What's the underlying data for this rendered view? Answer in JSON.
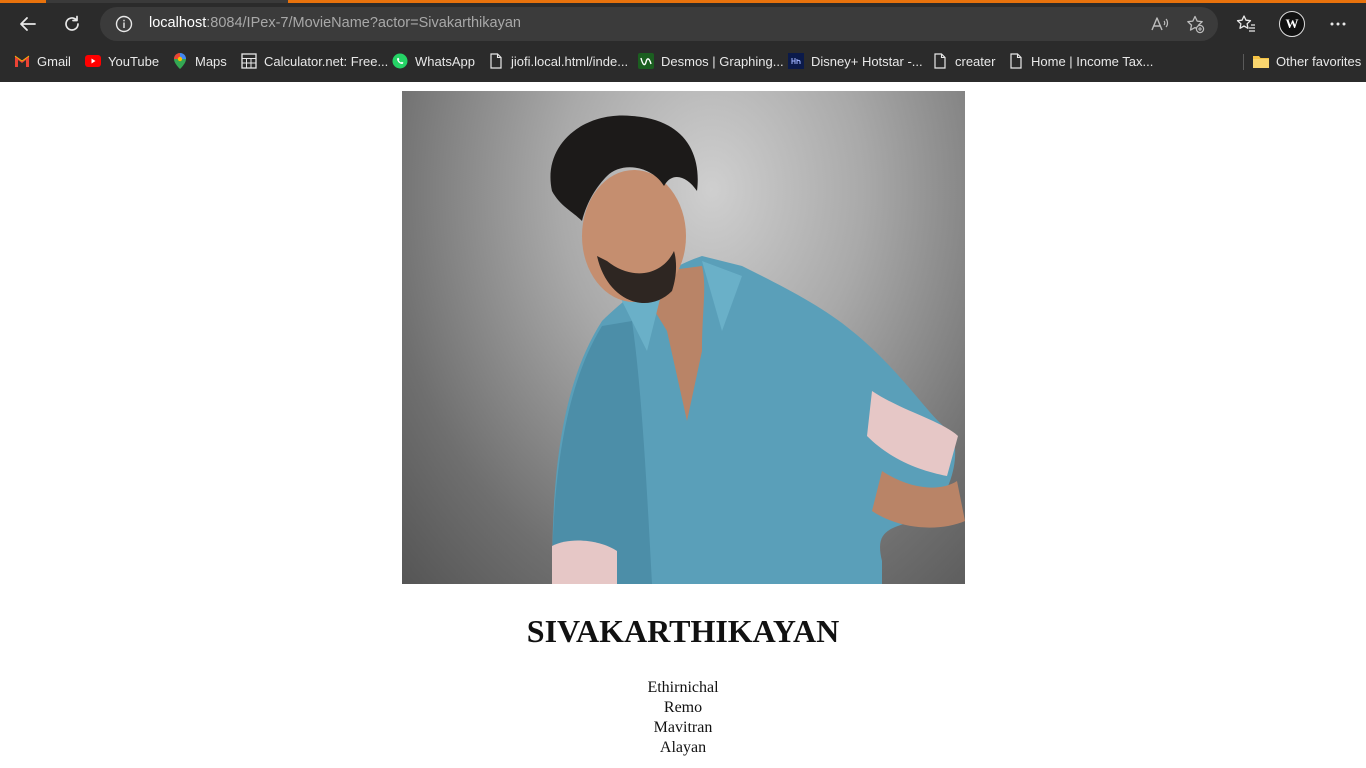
{
  "browser": {
    "url_host": "localhost",
    "url_rest": ":8084/IPex-7/MovieName?actor=Sivakarthikayan",
    "profile_initial": "W",
    "bookmarks": [
      {
        "label": "Gmail",
        "icon": "gmail-icon"
      },
      {
        "label": "YouTube",
        "icon": "youtube-icon"
      },
      {
        "label": "Maps",
        "icon": "maps-icon"
      },
      {
        "label": "Calculator.net: Free...",
        "icon": "calculator-icon"
      },
      {
        "label": "WhatsApp",
        "icon": "whatsapp-icon"
      },
      {
        "label": "jiofi.local.html/inde...",
        "icon": "page-icon"
      },
      {
        "label": "Desmos | Graphing...",
        "icon": "desmos-icon"
      },
      {
        "label": "Disney+ Hotstar -...",
        "icon": "hotstar-icon"
      },
      {
        "label": "creater",
        "icon": "page-icon"
      },
      {
        "label": "Home | Income Tax...",
        "icon": "page-icon"
      }
    ],
    "other_favorites": "Other favorites",
    "colors": {
      "accent": "#e8720c",
      "chrome": "#2b2b2b",
      "omnibox": "#3b3b3b"
    }
  },
  "page": {
    "actor_name": "SIVAKARTHIKAYAN",
    "movies": [
      "Ethirnichal",
      "Remo",
      "Mavitran",
      "Alayan"
    ]
  }
}
